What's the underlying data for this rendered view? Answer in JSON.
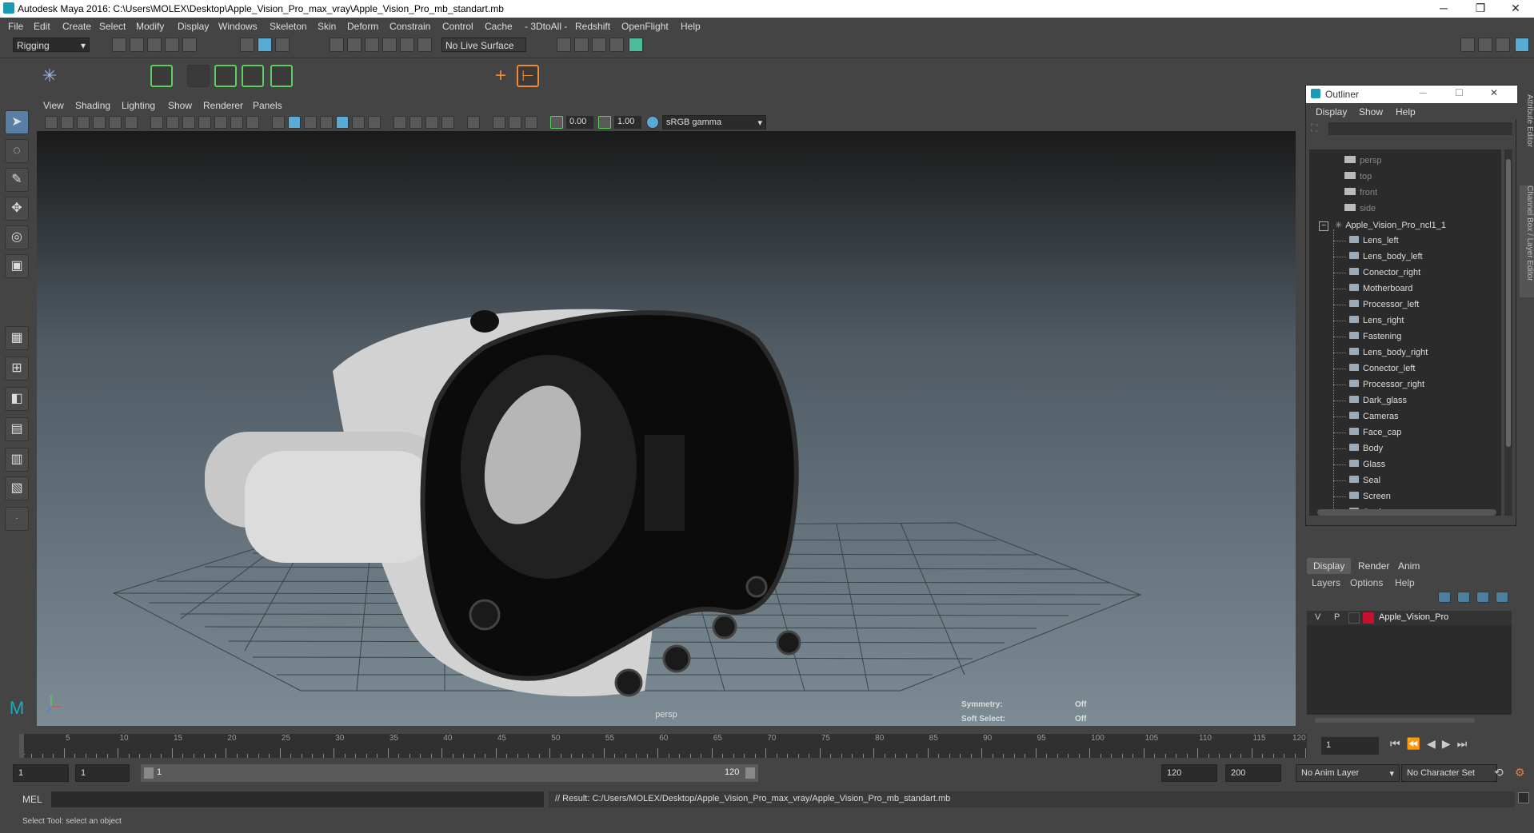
{
  "window": {
    "title": "Autodesk Maya 2016: C:\\Users\\MOLEX\\Desktop\\Apple_Vision_Pro_max_vray\\Apple_Vision_Pro_mb_standart.mb",
    "minimize": "─",
    "maximize": "❐",
    "close": "✕"
  },
  "menubar": [
    "File",
    "Edit",
    "Create",
    "Select",
    "Modify",
    "Display",
    "Windows",
    "Skeleton",
    "Skin",
    "Deform",
    "Constrain",
    "Control",
    "Cache",
    "- 3DtoAll -",
    "Redshift",
    "OpenFlight",
    "Help"
  ],
  "statusline": {
    "mode": "Rigging",
    "live_surface": "No Live Surface"
  },
  "viewport": {
    "menu": [
      "View",
      "Shading",
      "Lighting",
      "Show",
      "Renderer",
      "Panels"
    ],
    "near_value": "0.00",
    "far_value": "1.00",
    "color_space": "sRGB gamma",
    "camera_label": "persp",
    "symmetry_label": "Symmetry:",
    "symmetry_value": "Off",
    "soft_select_label": "Soft Select:",
    "soft_select_value": "Off"
  },
  "outliner": {
    "title": "Outliner",
    "menu": [
      "Display",
      "Show",
      "Help"
    ],
    "cameras": [
      "persp",
      "top",
      "front",
      "side"
    ],
    "group": "Apple_Vision_Pro_ncl1_1",
    "items": [
      "Lens_left",
      "Lens_body_left",
      "Conector_right",
      "Motherboard",
      "Processor_left",
      "Lens_right",
      "Fastening",
      "Lens_body_right",
      "Conector_left",
      "Processor_right",
      "Dark_glass",
      "Cameras",
      "Face_cap",
      "Body",
      "Glass",
      "Seal",
      "Screen",
      "Cooler"
    ]
  },
  "layer_editor": {
    "tabs": [
      "Display",
      "Render",
      "Anim"
    ],
    "menu": [
      "Layers",
      "Options",
      "Help"
    ],
    "layer": {
      "v": "V",
      "p": "P",
      "name": "Apple_Vision_Pro",
      "color": "#c8102e"
    }
  },
  "side_tabs": {
    "attribute_editor": "Attribute Editor",
    "channel_box": "Channel Box / Layer Editor"
  },
  "timeline": {
    "ticks": [
      "5",
      "10",
      "15",
      "20",
      "25",
      "30",
      "35",
      "40",
      "45",
      "50",
      "55",
      "60",
      "65",
      "70",
      "75",
      "80",
      "85",
      "90",
      "95",
      "100",
      "105",
      "110",
      "115",
      "120"
    ],
    "first": "1",
    "current_frame": "1"
  },
  "range": {
    "start": "1",
    "playback_start": "1",
    "range_left": "1",
    "range_right": "120",
    "playback_end": "120",
    "end": "200",
    "anim_layer": "No Anim Layer",
    "character_set": "No Character Set"
  },
  "command_line": {
    "mode": "MEL",
    "result": "// Result: C:/Users/MOLEX/Desktop/Apple_Vision_Pro_max_vray/Apple_Vision_Pro_mb_standart.mb"
  },
  "help_line": "Select Tool: select an object"
}
